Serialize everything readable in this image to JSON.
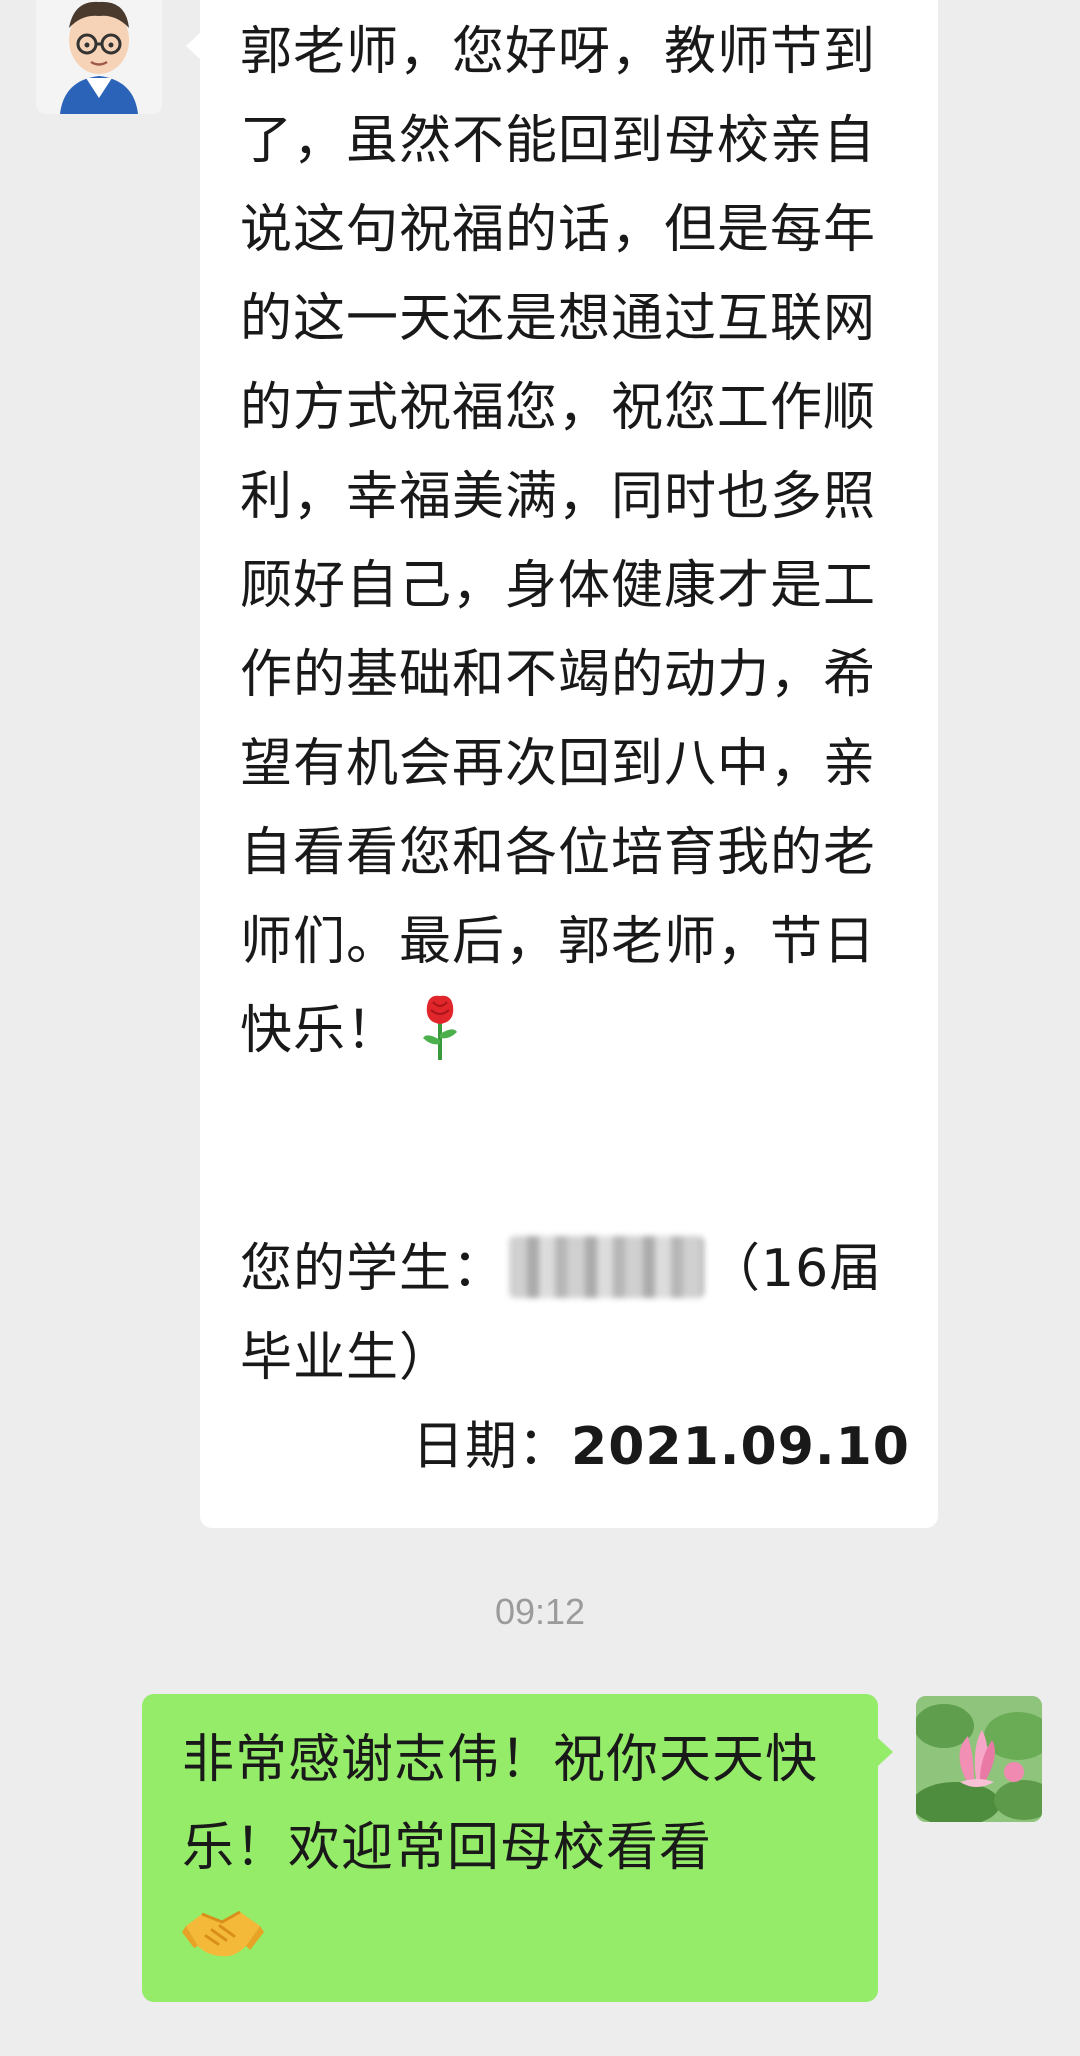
{
  "chat": {
    "incoming": {
      "avatar": "cartoon-teacher-avatar",
      "text": "郭老师，您好呀，教师节到了，虽然不能回到母校亲自说这句祝福的话，但是每年的这一天还是想通过互联网的方式祝福您，祝您工作顺利，幸福美满，同时也多照顾好自己，身体健康才是工作的基础和不竭的动力，希望有机会再次回到八中，亲自看看您和各位培育我的老师们。最后，郭老师，节日快乐！",
      "emoji": "rose-emoji",
      "signature_prefix": "您的学生：",
      "signature_suffix": "（16届",
      "signature_line2": "毕业生）",
      "date_label": "日期：",
      "date_value": "2021.09.10"
    },
    "timestamp": "09:12",
    "outgoing": {
      "avatar": "lotus-flower-avatar",
      "text": "非常感谢志伟！祝你天天快乐！欢迎常回母校看看",
      "emoji": "handshake-emoji"
    }
  },
  "colors": {
    "background": "#ededed",
    "incoming_bubble": "#ffffff",
    "outgoing_bubble": "#95ec69",
    "timestamp_text": "#9b9b9b"
  }
}
